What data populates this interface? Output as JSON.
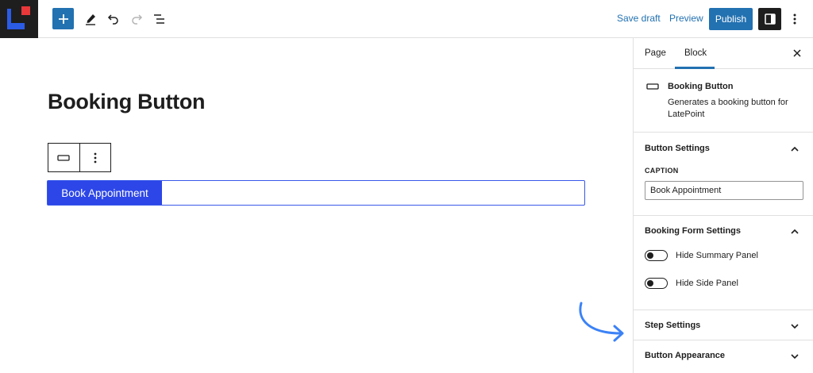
{
  "toolbar": {
    "save_draft": "Save draft",
    "preview": "Preview",
    "publish": "Publish",
    "icons": [
      "plus-icon",
      "pencil-icon",
      "undo-icon",
      "redo-icon",
      "list-view-icon",
      "sidebar-panel-icon",
      "more-vertical-icon"
    ]
  },
  "editor": {
    "page_title": "Booking Button",
    "button_label": "Book Appointment"
  },
  "sidebar": {
    "tabs": {
      "page": "Page",
      "block": "Block",
      "active": "Block"
    },
    "block_card": {
      "title": "Booking Button",
      "description": "Generates a booking button for LatePoint"
    },
    "panels": {
      "button_settings": {
        "title": "Button Settings",
        "expanded": true,
        "caption_label": "CAPTION",
        "caption_value": "Book Appointment"
      },
      "booking_form_settings": {
        "title": "Booking Form Settings",
        "expanded": true,
        "toggles": [
          {
            "label": "Hide Summary Panel",
            "checked": false
          },
          {
            "label": "Hide Side Panel",
            "checked": false
          }
        ]
      },
      "step_settings": {
        "title": "Step Settings",
        "expanded": false
      },
      "button_appearance": {
        "title": "Button Appearance",
        "expanded": false
      }
    }
  },
  "colors": {
    "primary": "#2271b1",
    "block_button": "#2c46e8",
    "selection_border": "#3858e9",
    "annotation_arrow": "#3b82f6",
    "dark": "#1e1e1e"
  }
}
